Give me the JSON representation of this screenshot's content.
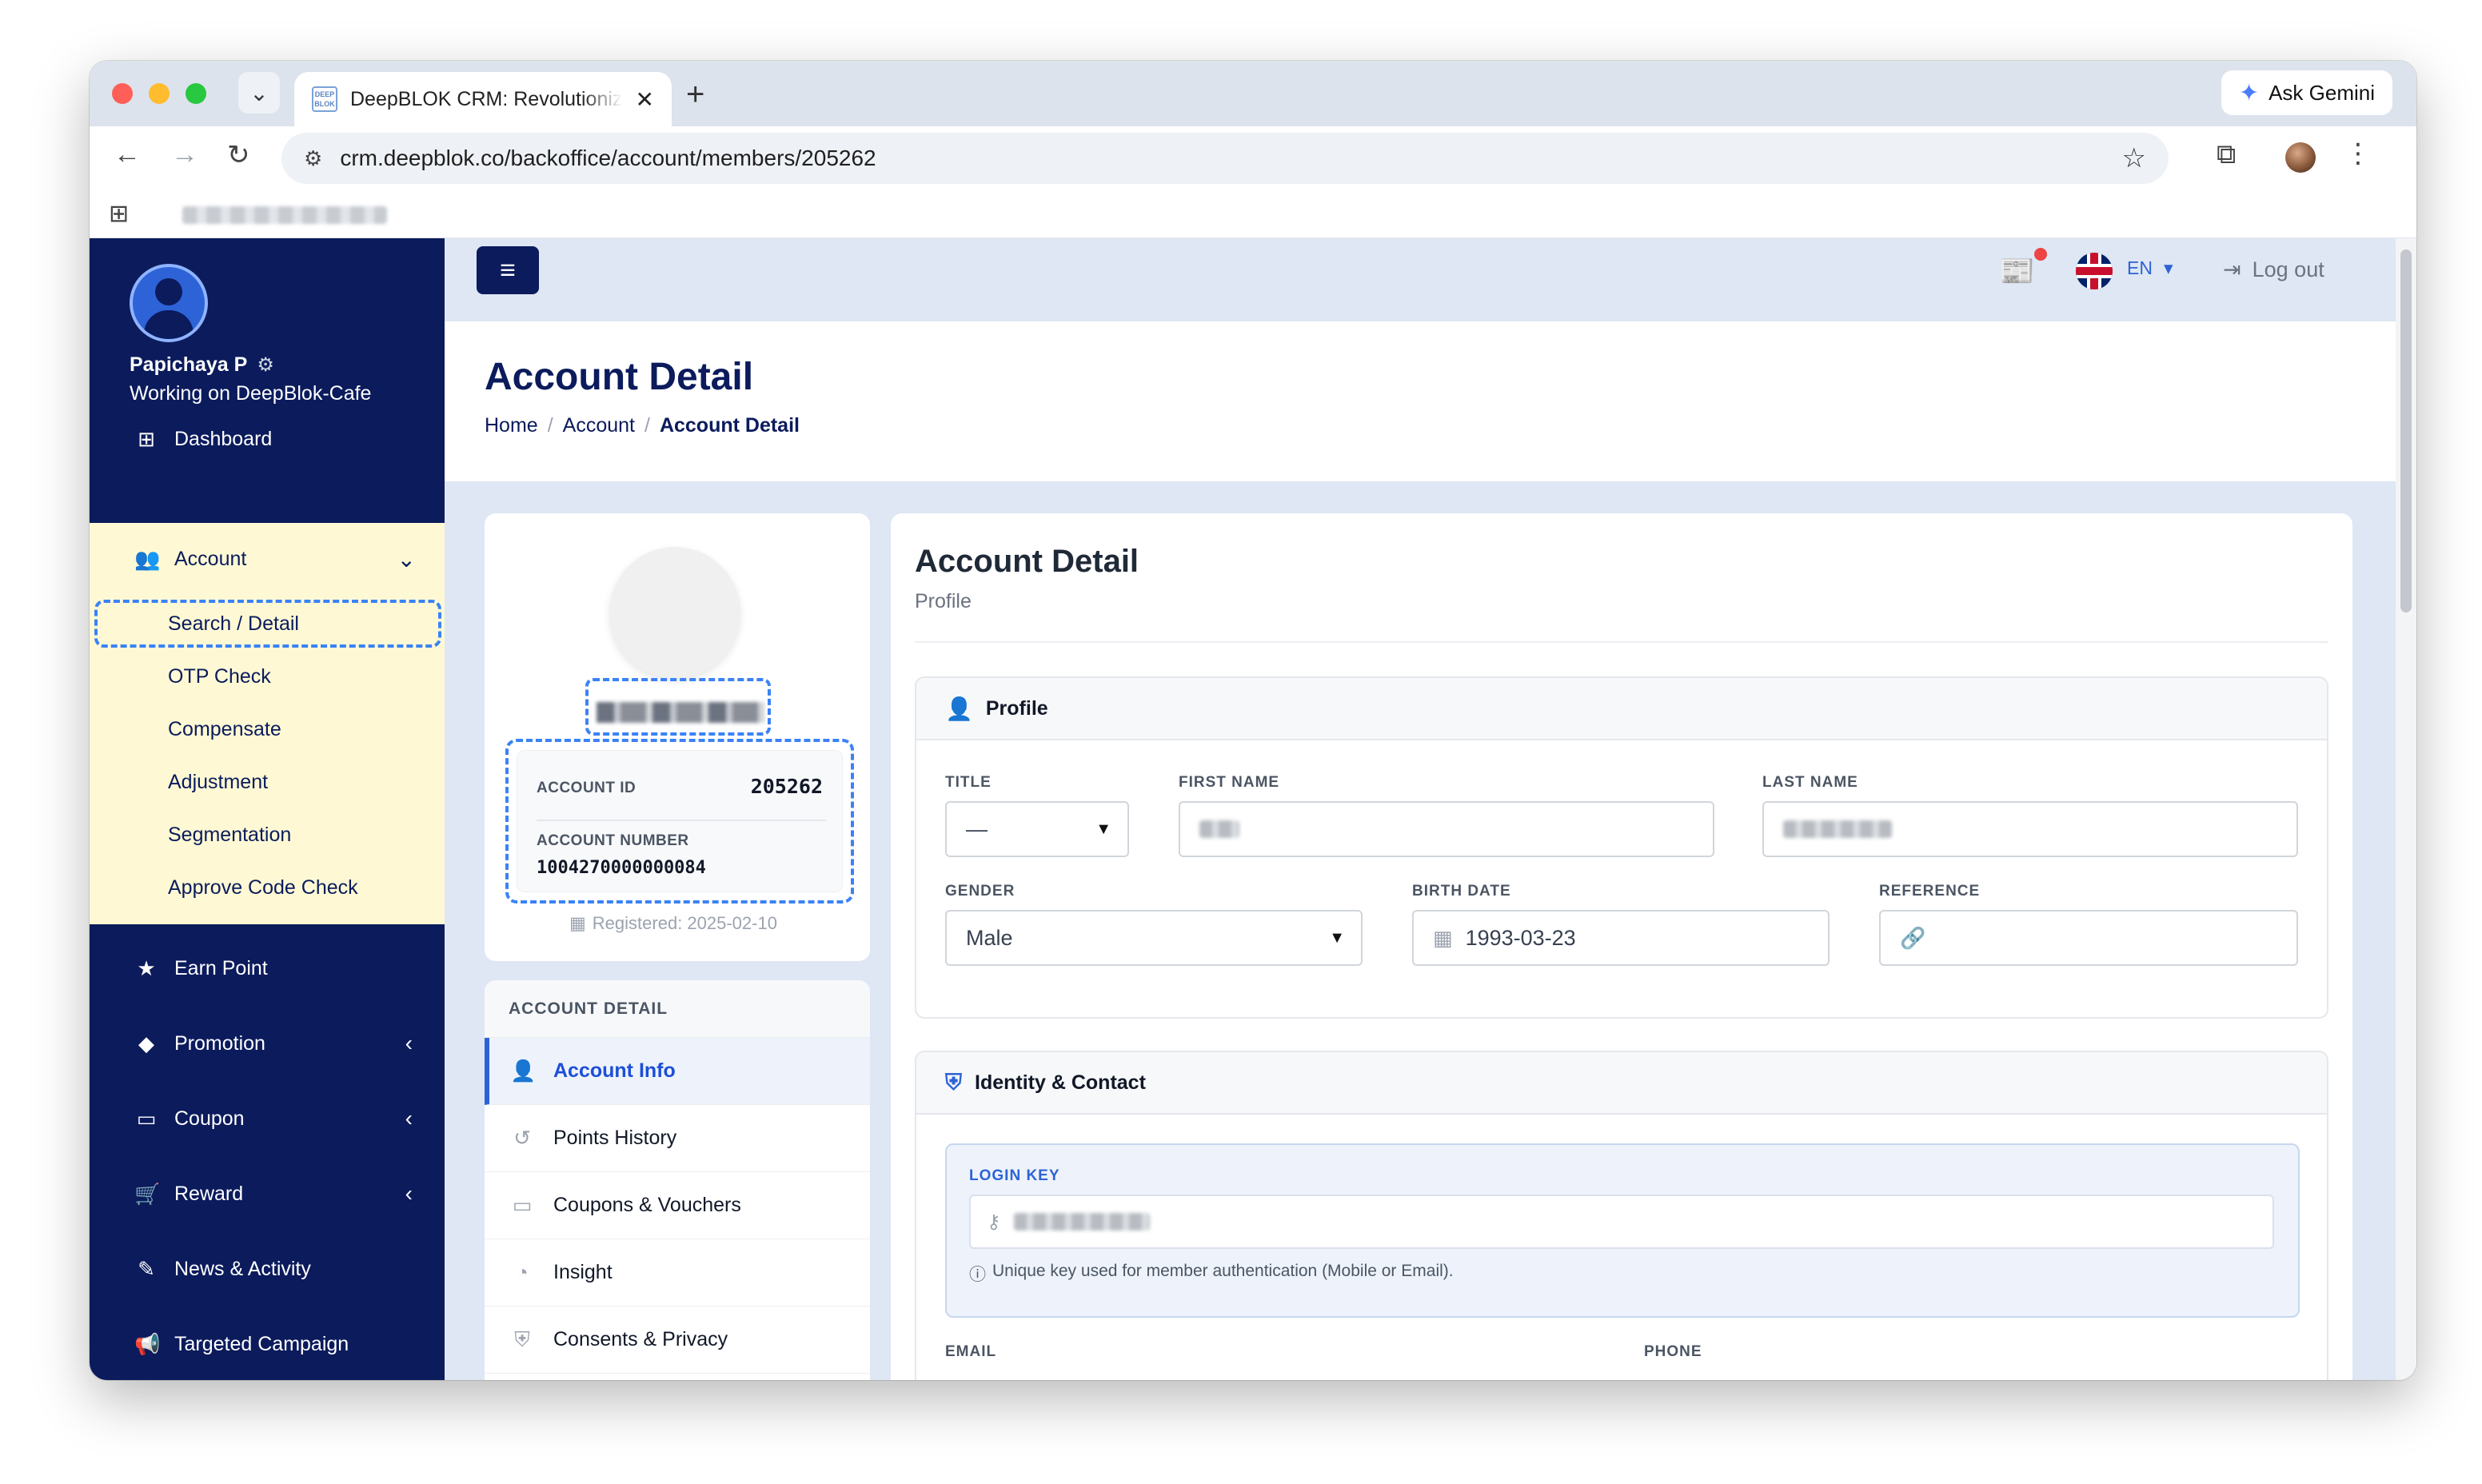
{
  "browser": {
    "tab_title": "DeepBLOK CRM: Revolutioniz",
    "favicon_text": "DEEP BLOK",
    "new_tab": "+",
    "close_tab": "✕",
    "url": "crm.deepblok.co/backoffice/account/members/205262",
    "gemini_label": "Ask Gemini"
  },
  "sidebar": {
    "user_name": "Papichaya P",
    "workspace": "Working on DeepBlok-Cafe",
    "dashboard": "Dashboard",
    "account": "Account",
    "account_sub": {
      "search_detail": "Search / Detail",
      "otp_check": "OTP Check",
      "compensate": "Compensate",
      "adjustment": "Adjustment",
      "segmentation": "Segmentation",
      "approve_code_check": "Approve Code Check"
    },
    "earn_point": "Earn Point",
    "promotion": "Promotion",
    "coupon": "Coupon",
    "reward": "Reward",
    "news_activity": "News & Activity",
    "targeted_campaign": "Targeted Campaign"
  },
  "topbar": {
    "language": "EN",
    "logout": "Log out"
  },
  "page": {
    "title": "Account Detail",
    "breadcrumb": [
      "Home",
      "Account",
      "Account Detail"
    ]
  },
  "profile_card": {
    "account_id_label": "ACCOUNT ID",
    "account_id": "205262",
    "account_number_label": "ACCOUNT NUMBER",
    "account_number": "1004270000000084",
    "registered": "Registered: 2025-02-10"
  },
  "detail_menu": {
    "heading": "ACCOUNT DETAIL",
    "items": [
      "Account Info",
      "Points History",
      "Coupons & Vouchers",
      "Insight",
      "Consents & Privacy"
    ]
  },
  "detail": {
    "title": "Account Detail",
    "subtitle": "Profile",
    "profile_section": "Profile",
    "title_label": "TITLE",
    "title_value": "—",
    "first_name_label": "FIRST NAME",
    "last_name_label": "LAST NAME",
    "gender_label": "GENDER",
    "gender_value": "Male",
    "birth_date_label": "BIRTH DATE",
    "birth_date_value": "1993-03-23",
    "reference_label": "REFERENCE",
    "identity_section": "Identity & Contact",
    "login_key_label": "LOGIN KEY",
    "login_key_help": "Unique key used for member authentication (Mobile or Email).",
    "email_label": "EMAIL",
    "phone_label": "PHONE"
  },
  "colors": {
    "sidebar_bg": "#0b1b5c",
    "accent": "#2d63d6",
    "highlight_bg": "#fef9d4",
    "content_bg": "#dee7f3"
  }
}
